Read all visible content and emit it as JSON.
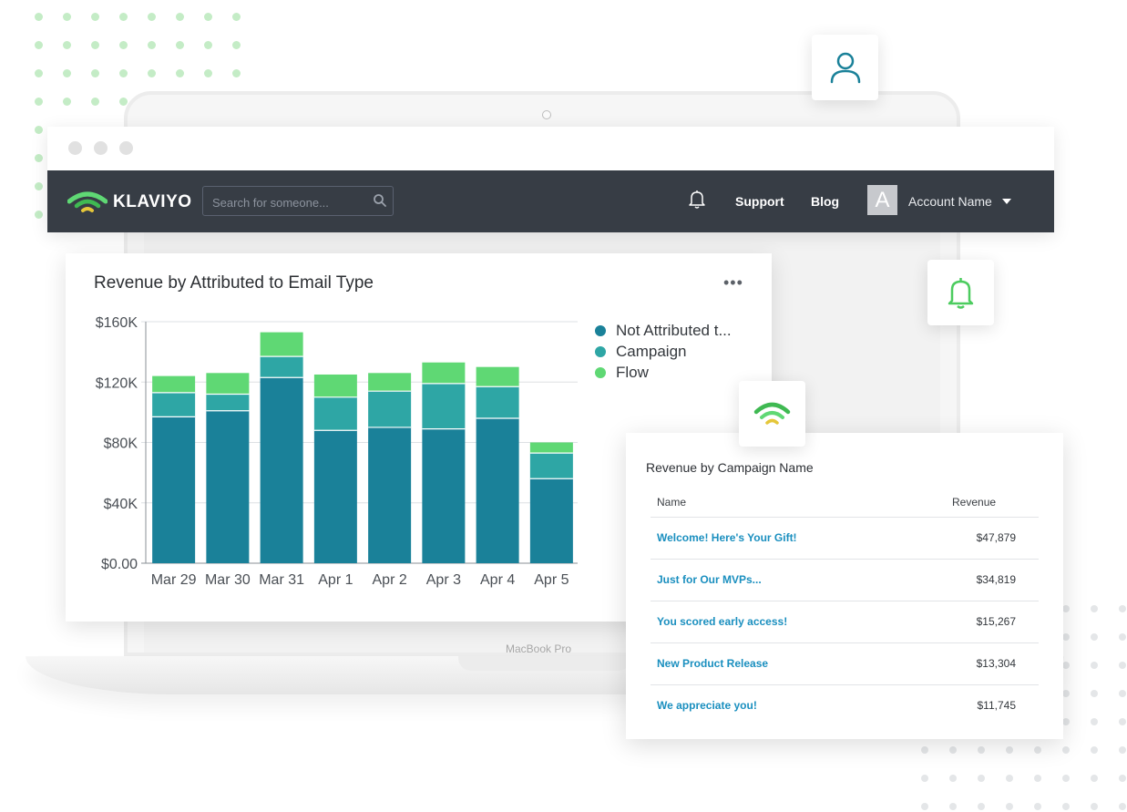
{
  "colors": {
    "not_attributed": "#1a8199",
    "campaign": "#2ea6a5",
    "flow": "#5fd874",
    "navbar": "#373d45",
    "link": "#1a8fbf",
    "dot_green": "#c4ecc6",
    "dot_grey": "#e4e6e8"
  },
  "laptop": {
    "label": "MacBook Pro"
  },
  "navbar": {
    "brand": "KLAVIYO",
    "search_placeholder": "Search for someone...",
    "support": "Support",
    "blog": "Blog",
    "avatar_letter": "A",
    "account": "Account Name"
  },
  "icons": [
    "klaviyo-logo-icon",
    "search-icon",
    "bell-icon",
    "chevron-down-icon",
    "user-icon",
    "more-icon"
  ],
  "chart_card": {
    "title": "Revenue by Attributed to Email Type",
    "more": "•••"
  },
  "chart_data": {
    "type": "bar",
    "stacked": true,
    "title": "Revenue by Attributed to Email Type",
    "categories": [
      "Mar 29",
      "Mar 30",
      "Mar 31",
      "Apr 1",
      "Apr 2",
      "Apr 3",
      "Apr 4",
      "Apr 5"
    ],
    "series": [
      {
        "name": "Not Attributed t...",
        "values": [
          97000,
          101000,
          123000,
          88000,
          90000,
          89000,
          96000,
          56000
        ]
      },
      {
        "name": "Campaign",
        "values": [
          16000,
          11000,
          14000,
          22000,
          24000,
          30000,
          21000,
          17000
        ]
      },
      {
        "name": "Flow",
        "values": [
          11000,
          14000,
          16000,
          15000,
          12000,
          14000,
          13000,
          7000
        ]
      }
    ],
    "yticks": [
      "$0.00",
      "$40K",
      "$80K",
      "$120K",
      "$160K"
    ],
    "ytick_values": [
      0,
      40000,
      80000,
      120000,
      160000
    ],
    "ylim": [
      0,
      160000
    ],
    "grid": true,
    "legend": "top-right"
  },
  "table_card": {
    "title": "Revenue by Campaign Name",
    "headers": {
      "name": "Name",
      "revenue": "Revenue"
    },
    "rows": [
      {
        "name": "Welcome! Here's Your Gift!",
        "revenue": "$47,879"
      },
      {
        "name": "Just for Our MVPs...",
        "revenue": "$34,819"
      },
      {
        "name": "You scored early access!",
        "revenue": "$15,267"
      },
      {
        "name": "New Product Release",
        "revenue": "$13,304"
      },
      {
        "name": "We appreciate you!",
        "revenue": "$11,745"
      }
    ]
  }
}
